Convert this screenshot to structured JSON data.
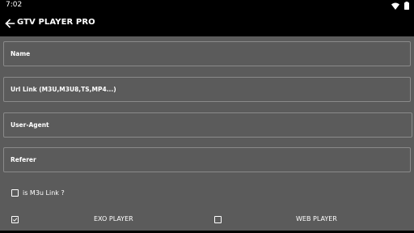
{
  "status_bar": {
    "time": "7:02",
    "icons": [
      "wifi-icon",
      "battery-icon"
    ]
  },
  "app_bar": {
    "title": "GTV PLAYER PRO",
    "back_icon": "arrow-back-icon"
  },
  "form": {
    "name": {
      "placeholder": "Name",
      "value": ""
    },
    "url": {
      "placeholder": "Url Link (M3U,M3U8,TS,MP4...)",
      "value": ""
    },
    "user_agent": {
      "placeholder": "User-Agent",
      "value": ""
    },
    "referer": {
      "placeholder": "Referer",
      "value": ""
    },
    "is_m3u": {
      "label": "is M3u Link ?",
      "checked": false
    },
    "exo_player": {
      "label": "EXO PLAYER",
      "checked": true
    },
    "web_player": {
      "label": "WEB PLAYER",
      "checked": false
    }
  },
  "colors": {
    "background": "#5b5b5b",
    "app_bar": "#000000",
    "text": "#ffffff",
    "field_border": "#8a8a8a"
  }
}
